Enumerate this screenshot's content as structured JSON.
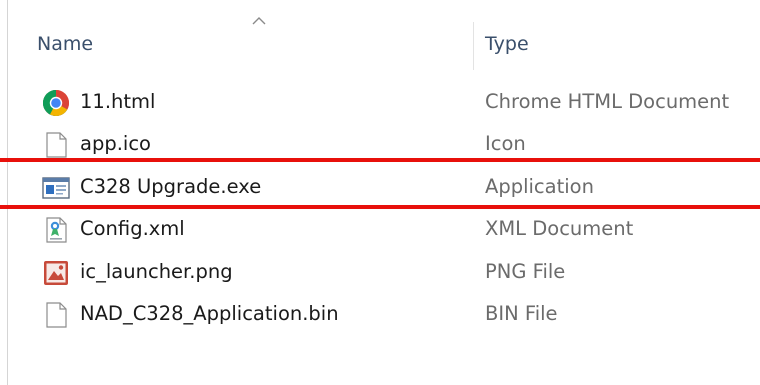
{
  "header": {
    "name_label": "Name",
    "type_label": "Type"
  },
  "files": [
    {
      "name": "11.html",
      "type": "Chrome HTML Document",
      "icon": "chrome-icon"
    },
    {
      "name": "app.ico",
      "type": "Icon",
      "icon": "blank-file-icon"
    },
    {
      "name": "C328 Upgrade.exe",
      "type": "Application",
      "icon": "application-window-icon"
    },
    {
      "name": "Config.xml",
      "type": "XML Document",
      "icon": "xml-document-icon"
    },
    {
      "name": "ic_launcher.png",
      "type": "PNG File",
      "icon": "png-image-icon"
    },
    {
      "name": "NAD_C328_Application.bin",
      "type": "BIN File",
      "icon": "blank-file-icon"
    }
  ],
  "colors": {
    "highlight_line": "#e8100b",
    "header_text": "#3a4f6b",
    "type_text": "#6b6b6b"
  }
}
